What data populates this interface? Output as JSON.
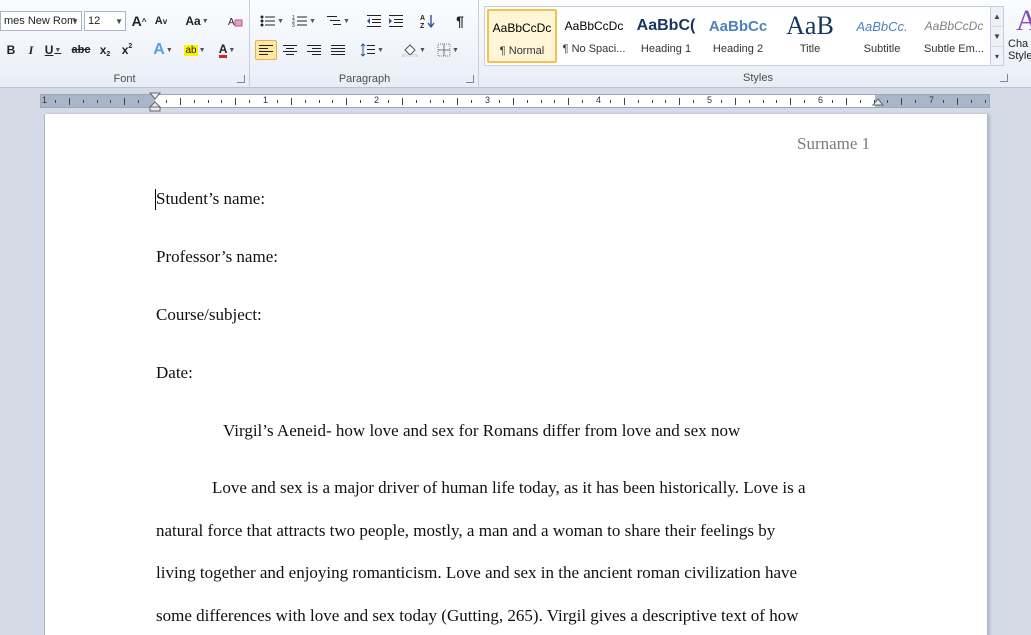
{
  "ribbon": {
    "font_group": {
      "label": "Font",
      "font_name": "mes New Rom",
      "font_size": "12",
      "grow_font": "A",
      "shrink_font": "A",
      "change_case": "Aa",
      "bold": "B",
      "italic": "I",
      "underline": "U",
      "strikethrough": "abc",
      "subscript": "x",
      "superscript": "x",
      "text_effects": "A",
      "highlight": "ab",
      "font_color": "A"
    },
    "paragraph_group": {
      "label": "Paragraph",
      "show_marks": "¶"
    },
    "styles_group": {
      "label": "Styles",
      "styles": [
        {
          "preview": "AaBbCcDc",
          "name": "¶ Normal"
        },
        {
          "preview": "AaBbCcDc",
          "name": "¶ No Spaci..."
        },
        {
          "preview": "AaBbC(",
          "name": "Heading 1"
        },
        {
          "preview": "AaBbCc",
          "name": "Heading 2"
        },
        {
          "preview": "AaB",
          "name": "Title"
        },
        {
          "preview": "AaBbCc.",
          "name": "Subtitle"
        },
        {
          "preview": "AaBbCcDc",
          "name": "Subtle Em..."
        }
      ],
      "change_styles_icon_text": "A",
      "change_styles_label_1": "Cha",
      "change_styles_label_2": "Style"
    }
  },
  "ruler": {
    "numbers": [
      "1",
      "1",
      "2",
      "3",
      "4",
      "5",
      "6",
      "7"
    ]
  },
  "document": {
    "header": "Surname 1",
    "lines": [
      "Student’s name:",
      "Professor’s name:",
      "Course/subject:",
      "Date:"
    ],
    "title": "Virgil’s Aeneid- how love and sex for Romans differ from love and sex now",
    "body": [
      "Love and sex is a major driver of human life today, as it has been historically. Love is a",
      "natural force that attracts two people, mostly, a man and a woman to share their feelings by",
      "living together and enjoying romanticism. Love and sex in the ancient roman civilization have",
      "some differences with love and sex today (Gutting, 265). Virgil gives a descriptive text of how"
    ]
  },
  "colors": {
    "ribbon_bg": "#e9eef6",
    "active_style_border": "#f2c14e",
    "header_text": "#7b7b7b",
    "heading_blue": "#17365d"
  }
}
